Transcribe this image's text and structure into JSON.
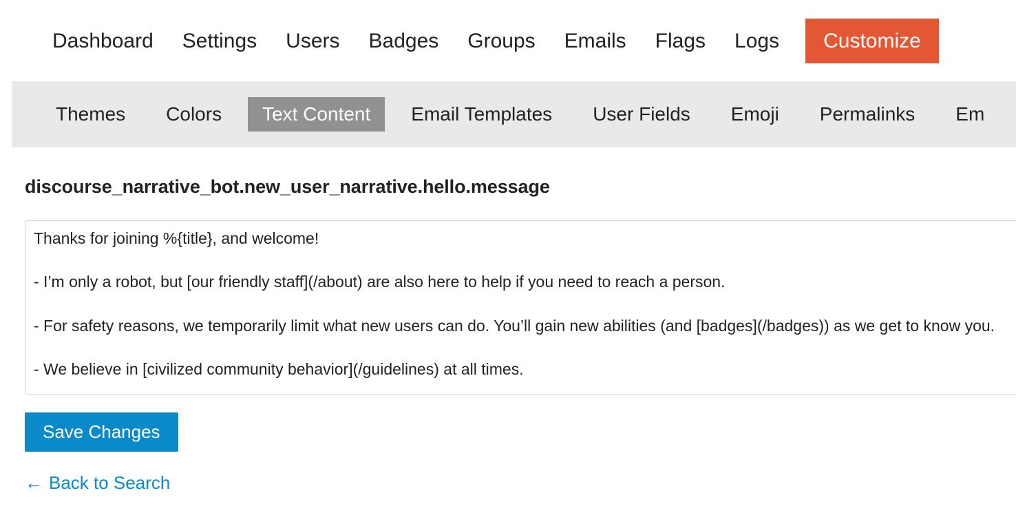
{
  "top_nav": {
    "items": [
      {
        "label": "Dashboard",
        "active": false
      },
      {
        "label": "Settings",
        "active": false
      },
      {
        "label": "Users",
        "active": false
      },
      {
        "label": "Badges",
        "active": false
      },
      {
        "label": "Groups",
        "active": false
      },
      {
        "label": "Emails",
        "active": false
      },
      {
        "label": "Flags",
        "active": false
      },
      {
        "label": "Logs",
        "active": false
      },
      {
        "label": "Customize",
        "active": true
      }
    ],
    "active_accent_color": "#e45735"
  },
  "sub_nav": {
    "items": [
      {
        "label": "Themes",
        "active": false
      },
      {
        "label": "Colors",
        "active": false
      },
      {
        "label": "Text Content",
        "active": true
      },
      {
        "label": "Email Templates",
        "active": false
      },
      {
        "label": "User Fields",
        "active": false
      },
      {
        "label": "Emoji",
        "active": false
      },
      {
        "label": "Permalinks",
        "active": false
      },
      {
        "label": "Em",
        "active": false
      }
    ],
    "background_color": "#e9e9e9",
    "active_background_color": "#919191"
  },
  "main": {
    "page_title": "discourse_narrative_bot.new_user_narrative.hello.message",
    "editor": {
      "value": "Thanks for joining %{title}, and welcome!\n\n- I’m only a robot, but [our friendly staff](/about) are also here to help if you need to reach a person.\n\n- For safety reasons, we temporarily limit what new users can do. You’ll gain new abilities (and [badges](/badges)) as we get to know you.\n\n- We believe in [civilized community behavior](/guidelines) at all times.",
      "placeholder": ""
    },
    "save_button_label": "Save Changes",
    "save_button_color": "#0b8ac9",
    "back_link_label": "Back to Search",
    "back_link_icon": "arrow-left-icon",
    "back_link_arrow_glyph": "←"
  }
}
